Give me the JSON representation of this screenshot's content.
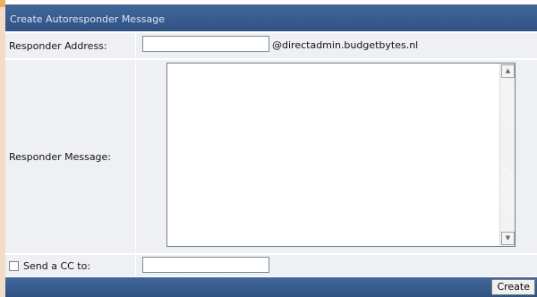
{
  "form": {
    "title": "Create Autoresponder Message",
    "address_label": "Responder Address:",
    "address_value": "",
    "domain_suffix": "@directadmin.budgetbytes.nl",
    "message_label": "Responder Message:",
    "message_value": "",
    "cc_label": "Send a CC to:",
    "cc_checked": false,
    "cc_value": "",
    "create_label": "Create"
  },
  "icons": {
    "scroll_up": "scroll-up-arrow-icon",
    "scroll_down": "scroll-down-arrow-icon"
  },
  "colors": {
    "header": "#3a5d8f",
    "row_bg": "#eef0f3",
    "left_strip": "#f3dcc6"
  }
}
